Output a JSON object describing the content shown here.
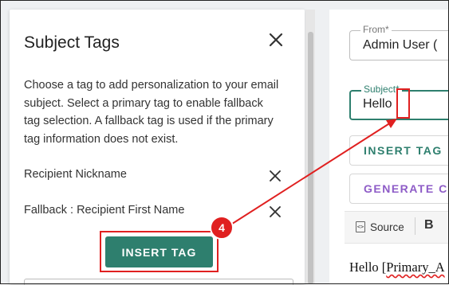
{
  "panel": {
    "title": "Subject Tags",
    "description": "Choose a tag to add personalization to your email subject. Select a primary tag to enable fallback tag selection. A fallback tag is used if the primary tag information does not exist.",
    "tags": [
      {
        "label": "Recipient Nickname"
      },
      {
        "label": "Fallback : Recipient First Name"
      }
    ],
    "insert_button": "INSERT TAG"
  },
  "form": {
    "from_label": "From*",
    "from_value": "Admin User (",
    "subject_label": "Subject*",
    "subject_value": "Hello",
    "insert_tag_button": "INSERT TAG",
    "generate_button": "GENERATE CO"
  },
  "toolbar": {
    "source_label": "Source",
    "bold_label": "B"
  },
  "editor": {
    "text_prefix": "Hello [",
    "text_squiggle": "Primary_A"
  },
  "annotation": {
    "step": "4"
  },
  "colors": {
    "accent": "#2e7f6e",
    "generate": "#8e5cc7",
    "annotation": "#e02020"
  }
}
